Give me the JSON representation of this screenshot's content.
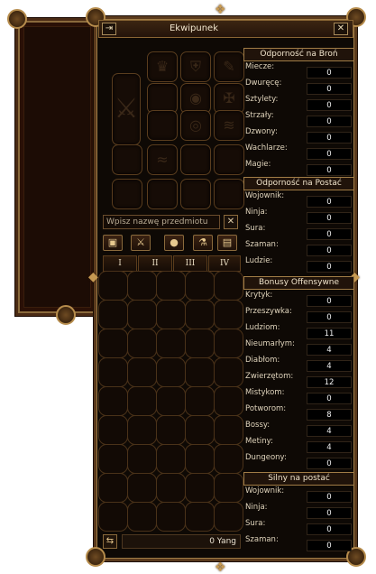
{
  "window": {
    "title": "Ekwipunek",
    "move_icon": "⇥",
    "close_icon": "✕"
  },
  "search": {
    "placeholder": "Wpisz nazwę przedmiotu",
    "clear_icon": "✕"
  },
  "tools": [
    {
      "icon": "▣",
      "name": "armor-filter-icon"
    },
    {
      "icon": "⚔",
      "name": "weapon-filter-icon"
    },
    {
      "icon": "●",
      "name": "orb-filter-icon"
    },
    {
      "icon": "⚗",
      "name": "potion-filter-icon"
    },
    {
      "icon": "▤",
      "name": "chest-filter-icon"
    }
  ],
  "pages": [
    "I",
    "II",
    "III",
    "IV"
  ],
  "money": {
    "exchange_icon": "⇆",
    "amount": "0 Yang"
  },
  "equipment_icons": [
    "♛",
    "⛨",
    "✎",
    "◉",
    "✠",
    "◎",
    "≋",
    "≈"
  ],
  "stats": {
    "weapon_resist": {
      "title": "Odporność na Broń",
      "rows": [
        {
          "label": "Miecze:",
          "value": "0"
        },
        {
          "label": "Dwuręcę:",
          "value": "0"
        },
        {
          "label": "Sztylety:",
          "value": "0"
        },
        {
          "label": "Strzały:",
          "value": "0"
        },
        {
          "label": "Dzwony:",
          "value": "0"
        },
        {
          "label": "Wachlarze:",
          "value": "0"
        },
        {
          "label": "Magie:",
          "value": "0"
        }
      ]
    },
    "class_resist": {
      "title": "Odporność na Postać",
      "rows": [
        {
          "label": "Wojownik:",
          "value": "0"
        },
        {
          "label": "Ninja:",
          "value": "0"
        },
        {
          "label": "Sura:",
          "value": "0"
        },
        {
          "label": "Szaman:",
          "value": "0"
        },
        {
          "label": "Ludzie:",
          "value": "0"
        }
      ]
    },
    "offensive": {
      "title": "Bonusy Offensywne",
      "rows": [
        {
          "label": "Krytyk:",
          "value": "0"
        },
        {
          "label": "Przeszywka:",
          "value": "0"
        },
        {
          "label": "Ludziom:",
          "value": "11"
        },
        {
          "label": "Nieumarłym:",
          "value": "4"
        },
        {
          "label": "Diabłom:",
          "value": "4"
        },
        {
          "label": "Zwierzętom:",
          "value": "12"
        },
        {
          "label": "Mistykom:",
          "value": "0"
        },
        {
          "label": "Potworom:",
          "value": "8"
        },
        {
          "label": "Bossy:",
          "value": "4"
        },
        {
          "label": "Metiny:",
          "value": "4"
        },
        {
          "label": "Dungeony:",
          "value": "0"
        }
      ]
    },
    "strong_vs": {
      "title": "Silny na postać",
      "rows": [
        {
          "label": "Wojownik:",
          "value": "0"
        },
        {
          "label": "Ninja:",
          "value": "0"
        },
        {
          "label": "Sura:",
          "value": "0"
        },
        {
          "label": "Szaman:",
          "value": "0"
        }
      ]
    }
  }
}
